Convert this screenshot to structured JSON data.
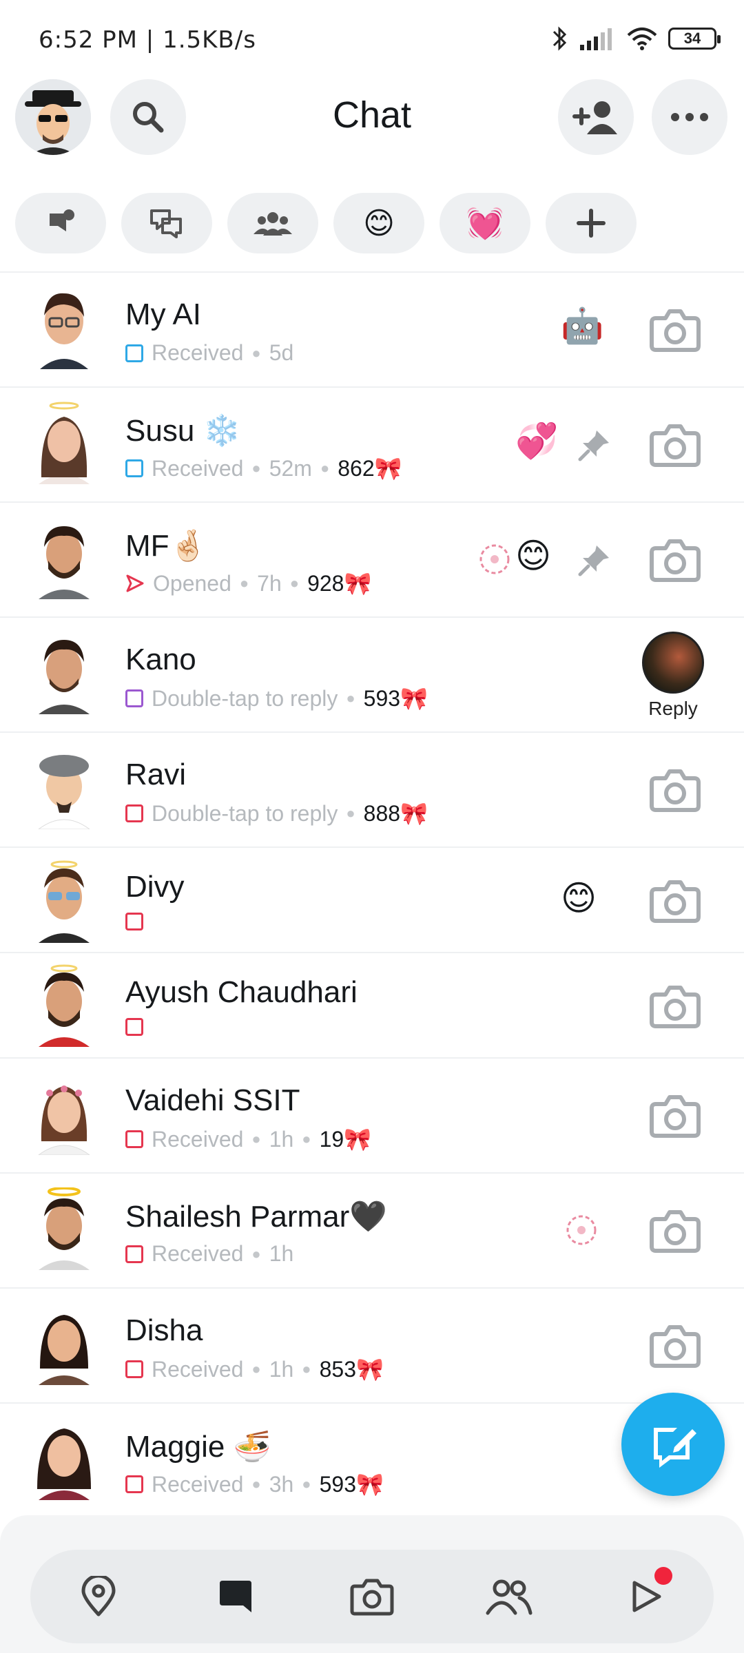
{
  "status_bar": {
    "time_speed": "6:52 PM | 1.5KB/s",
    "battery": "34",
    "icons": [
      "bluetooth-icon",
      "signal-icon",
      "wifi-icon",
      "battery-icon"
    ]
  },
  "header": {
    "title": "Chat",
    "buttons": [
      "profile-avatar",
      "search-icon",
      "add-friend-icon",
      "more-icon"
    ]
  },
  "filters": [
    "unread-icon",
    "chats-icon",
    "groups-icon",
    "smiley-emoji",
    "heart-emoji",
    "plus-icon"
  ],
  "colors": {
    "accent_blue": "#1eaeed",
    "received_blue": "#2ea8e6",
    "opened_red": "#e5364f",
    "reply_purple": "#9b58d0",
    "chip_bg": "#eef0f2"
  },
  "chats": [
    {
      "name": "My AI",
      "status": "Received",
      "time": "5d",
      "streak": "",
      "badge": "🤖",
      "pinned": false,
      "action": "camera"
    },
    {
      "name": "Susu ❄️",
      "status": "Received",
      "time": "52m",
      "streak": "862🎀",
      "badge": "💞",
      "pinned": true,
      "action": "camera"
    },
    {
      "name": "MF🤞🏻",
      "status": "Opened",
      "time": "7h",
      "streak": "928🎀",
      "badge": "😊",
      "pinned": true,
      "action": "camera"
    },
    {
      "name": "Kano",
      "status": "Double-tap to reply",
      "time": "",
      "streak": "593🎀",
      "badge": "",
      "pinned": false,
      "action": "reply",
      "action_label": "Reply"
    },
    {
      "name": "Ravi",
      "status": "Double-tap to reply",
      "time": "",
      "streak": "888🎀",
      "badge": "",
      "pinned": false,
      "action": "camera"
    },
    {
      "name": "Divy",
      "status": "",
      "time": "",
      "streak": "",
      "badge": "😊",
      "pinned": false,
      "action": "camera"
    },
    {
      "name": "Ayush Chaudhari",
      "status": "",
      "time": "",
      "streak": "",
      "badge": "",
      "pinned": false,
      "action": "camera"
    },
    {
      "name": "Vaidehi SSIT",
      "status": "Received",
      "time": "1h",
      "streak": "19🎀",
      "badge": "",
      "pinned": false,
      "action": "camera"
    },
    {
      "name": "Shailesh Parmar🖤",
      "status": "Received",
      "time": "1h",
      "streak": "",
      "badge": "",
      "pinned": false,
      "action": "camera"
    },
    {
      "name": "Disha",
      "status": "Received",
      "time": "1h",
      "streak": "853🎀",
      "badge": "",
      "pinned": false,
      "action": "camera"
    },
    {
      "name": "Maggie 🍜",
      "status": "Received",
      "time": "3h",
      "streak": "593🎀",
      "badge": "",
      "pinned": false,
      "action": "camera"
    }
  ],
  "bottom_nav": [
    "map-icon",
    "chat-icon",
    "camera-icon",
    "friends-icon",
    "spotlight-icon"
  ]
}
